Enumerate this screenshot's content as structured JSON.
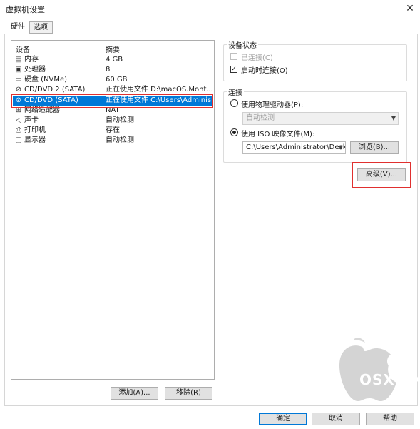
{
  "window": {
    "title": "虚拟机设置",
    "close_glyph": "✕"
  },
  "tabs": [
    {
      "label": "硬件",
      "active": true
    },
    {
      "label": "选项",
      "active": false
    }
  ],
  "device_list": {
    "columns": {
      "device": "设备",
      "summary": "摘要"
    },
    "rows": [
      {
        "icon": "memory-icon",
        "name": "内存",
        "summary": "4 GB"
      },
      {
        "icon": "processor-icon",
        "name": "处理器",
        "summary": "8"
      },
      {
        "icon": "hard-disk-icon",
        "name": "硬盘 (NVMe)",
        "summary": "60 GB"
      },
      {
        "icon": "cd-dvd-icon",
        "name": "CD/DVD 2 (SATA)",
        "summary": "正在使用文件 D:\\macOS.Mont..."
      },
      {
        "icon": "cd-dvd-icon",
        "name": "CD/DVD (SATA)",
        "summary": "正在使用文件 C:\\Users\\Adminis...",
        "selected": true
      },
      {
        "icon": "network-adapter-icon",
        "name": "网络适配器",
        "summary": "NAT"
      },
      {
        "icon": "sound-card-icon",
        "name": "声卡",
        "summary": "自动检测"
      },
      {
        "icon": "printer-icon",
        "name": "打印机",
        "summary": "存在"
      },
      {
        "icon": "display-icon",
        "name": "显示器",
        "summary": "自动检测"
      }
    ],
    "add_button": "添加(A)...",
    "remove_button": "移除(R)"
  },
  "device_status": {
    "group_label": "设备状态",
    "connected_label": "已连接(C)",
    "connected_checked": false,
    "connected_enabled": false,
    "connect_at_power_on_label": "启动时连接(O)",
    "connect_at_power_on_checked": true
  },
  "connection": {
    "group_label": "连接",
    "physical_drive_label": "使用物理驱动器(P):",
    "physical_drive_selected": false,
    "physical_drive_value": "自动检测",
    "iso_label": "使用 ISO 映像文件(M):",
    "iso_selected": true,
    "iso_path": "C:\\Users\\Administrator\\Desk",
    "browse_button": "浏览(B)..."
  },
  "advanced_button": "高级(V)...",
  "footer": {
    "ok": "确定",
    "cancel": "取消",
    "help": "帮助"
  },
  "watermark": {
    "text": "OSX.CX"
  },
  "colors": {
    "selection": "#0078d7",
    "highlight_box": "#e0302f",
    "default_button_border": "#0078d7"
  }
}
